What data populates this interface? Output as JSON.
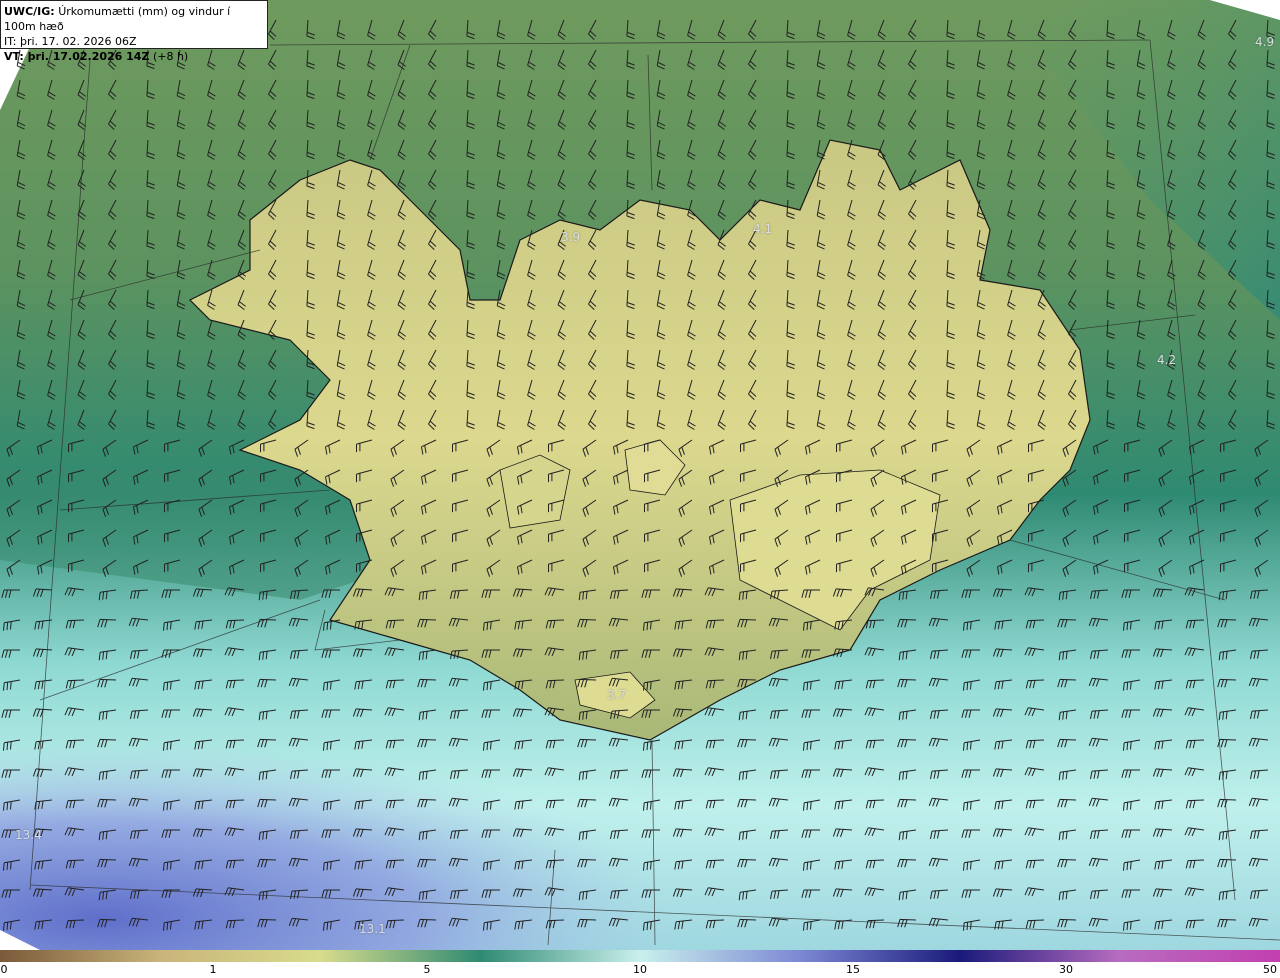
{
  "title": {
    "model": "UWC/IG:",
    "description": "Úrkomumætti (mm) og vindur í 100m hæð",
    "initial_time": "IT: þri. 17. 02. 2026 06Z",
    "valid_label": "VT: þri. 17.02.2026 14Z",
    "lead_time": "(+8 h)"
  },
  "map_labels": [
    {
      "id": "label-4-9",
      "text": "4.9"
    },
    {
      "id": "label-3-9",
      "text": "3.9"
    },
    {
      "id": "label-4-1",
      "text": "4.1"
    },
    {
      "id": "label-4-2",
      "text": "4.2"
    },
    {
      "id": "label-3-7",
      "text": "3.7"
    },
    {
      "id": "label-13-4",
      "text": "13.4"
    },
    {
      "id": "label-13-1",
      "text": "13.1"
    }
  ],
  "colorbar": {
    "ticks": [
      "0",
      "1",
      "5",
      "10",
      "15",
      "30",
      "50"
    ],
    "colors": [
      "#7a5a3a",
      "#c9b47a",
      "#d8dc8c",
      "#2f8a72",
      "#c9f0ec",
      "#7c88d4",
      "#1a1a7a",
      "#b86cc0",
      "#c23fb0"
    ]
  },
  "colors": {
    "land_light": "#d9d48a",
    "sea_green": "#3d8a72",
    "sea_light": "#b8ecea",
    "sea_blue": "#7f8fd6",
    "coast": "#1a1a1a"
  }
}
